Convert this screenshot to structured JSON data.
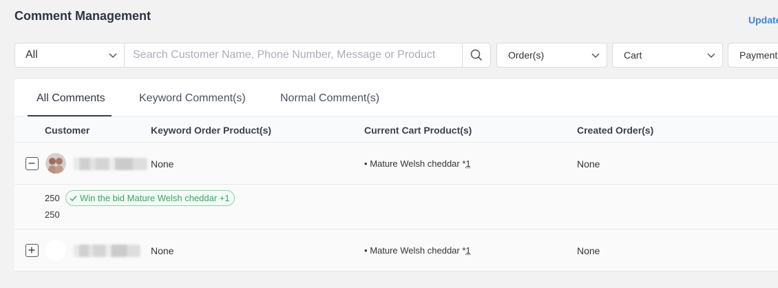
{
  "header": {
    "title": "Comment Management",
    "update_label": "Update"
  },
  "filters": {
    "scope_value": "All",
    "search_placeholder": "Search Customer Name, Phone Number, Message or Product",
    "order_label": "Order(s)",
    "cart_label": "Cart",
    "payment_label": "Payment"
  },
  "tabs": [
    {
      "label": "All Comments",
      "active": true
    },
    {
      "label": "Keyword Comment(s)",
      "active": false
    },
    {
      "label": "Normal Comment(s)",
      "active": false
    }
  ],
  "table": {
    "columns": [
      "Customer",
      "Keyword Order Product(s)",
      "Current Cart Product(s)",
      "Created Order(s)"
    ],
    "rows": [
      {
        "expanded": true,
        "keyword_products": "None",
        "cart_bullet": "•",
        "cart_product": "Mature Welsh cheddar *",
        "cart_qty": "1",
        "created_orders": "None",
        "comments": [
          {
            "text": "250",
            "badge": "Win the bid Mature Welsh cheddar +1"
          },
          {
            "text": "250",
            "badge": ""
          }
        ]
      },
      {
        "expanded": false,
        "keyword_products": "None",
        "cart_bullet": "•",
        "cart_product": "Mature Welsh cheddar *",
        "cart_qty": "1",
        "created_orders": "None"
      }
    ]
  },
  "colors": {
    "accent": "#3b82e6",
    "badge_green": "#3aa36a"
  },
  "icons": [
    "chevron-down-icon",
    "search-icon",
    "minus-icon",
    "plus-icon",
    "check-icon"
  ]
}
